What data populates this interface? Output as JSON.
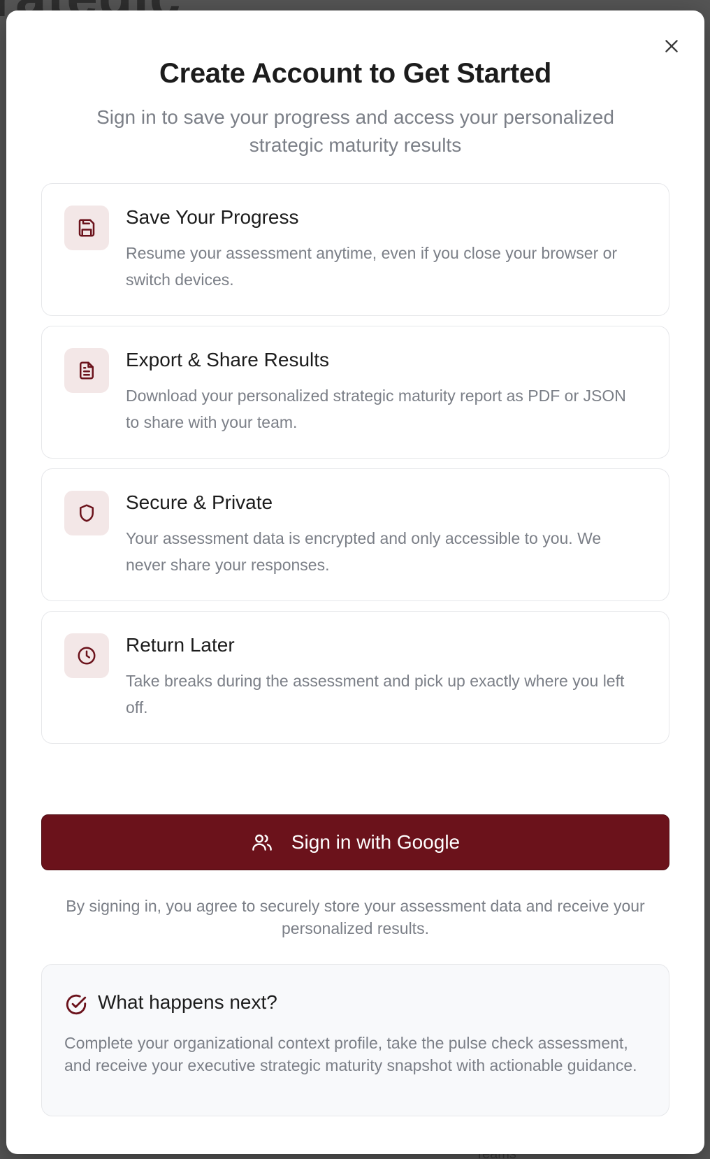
{
  "background": {
    "heading_fragment": "rategic",
    "bottom_fragment": "Teams"
  },
  "modal": {
    "title": "Create Account to Get Started",
    "subtitle": "Sign in to save your progress and access your personalized strategic maturity results",
    "close_icon": "close-icon"
  },
  "features": [
    {
      "icon": "save-icon",
      "title": "Save Your Progress",
      "description": "Resume your assessment anytime, even if you close your browser or switch devices."
    },
    {
      "icon": "document-icon",
      "title": "Export & Share Results",
      "description": "Download your personalized strategic maturity report as PDF or JSON to share with your team."
    },
    {
      "icon": "shield-icon",
      "title": "Secure & Private",
      "description": "Your assessment data is encrypted and only accessible to you. We never share your responses."
    },
    {
      "icon": "clock-icon",
      "title": "Return Later",
      "description": "Take breaks during the assessment and pick up exactly where you left off."
    }
  ],
  "sign_in": {
    "label": "Sign in with Google",
    "icon": "users-icon"
  },
  "terms": "By signing in, you agree to securely store your assessment data and receive your personalized results.",
  "next_steps": {
    "icon": "check-circle-icon",
    "title": "What happens next?",
    "description": "Complete your organizational context profile, take the pulse check assessment, and receive your executive strategic maturity snapshot with actionable guidance."
  },
  "colors": {
    "brand": "#6b121b",
    "icon_bg": "#f3e7e7",
    "muted_text": "#7b7f87",
    "heading_text": "#1c1c1c"
  }
}
